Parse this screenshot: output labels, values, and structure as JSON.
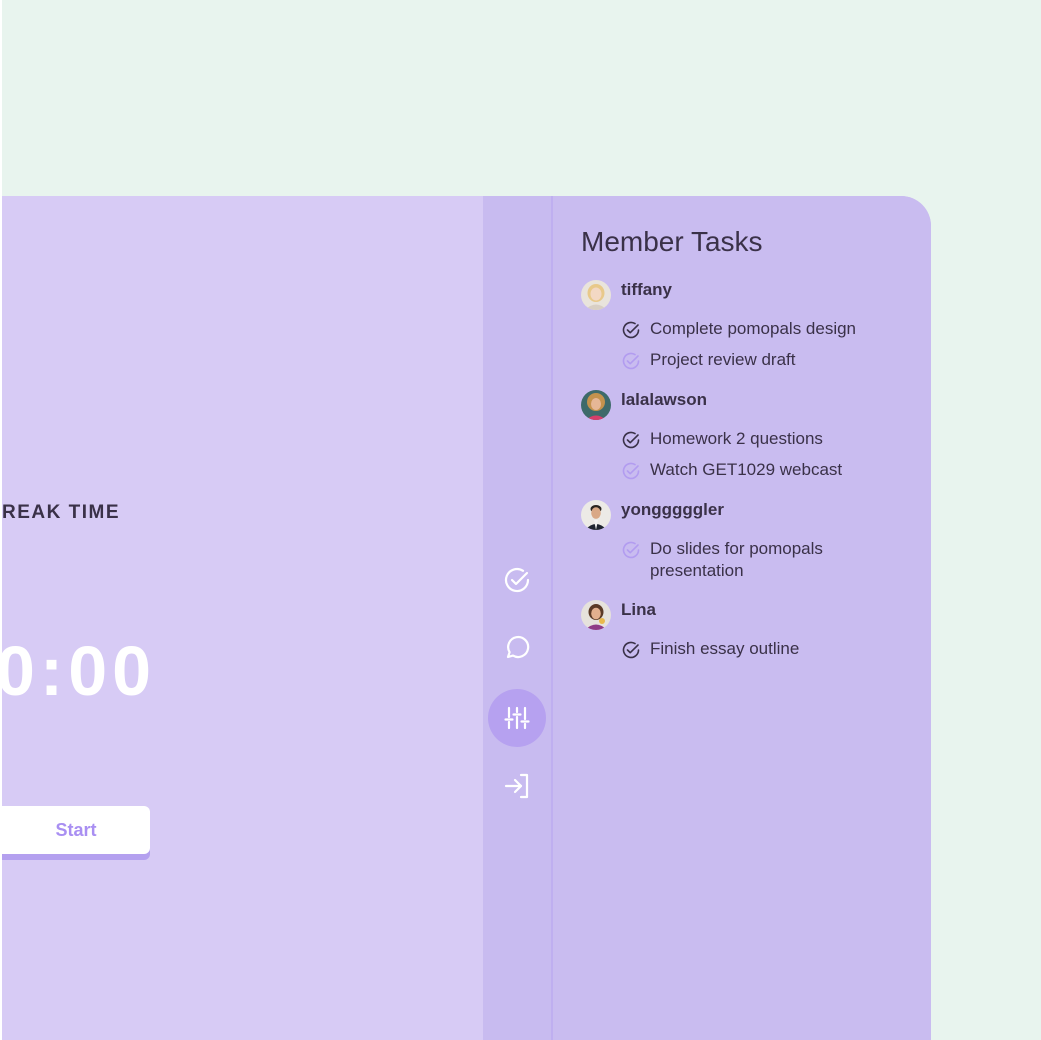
{
  "timer": {
    "mode_label": "REAK TIME",
    "display": "0:00",
    "start_label": "Start"
  },
  "rail": {
    "items": [
      {
        "icon": "check-circle-icon",
        "active": false
      },
      {
        "icon": "chat-bubble-icon",
        "active": false
      },
      {
        "icon": "sliders-icon",
        "active": true
      },
      {
        "icon": "exit-arrow-icon",
        "active": false
      }
    ]
  },
  "tasks_panel": {
    "title": "Member Tasks",
    "members": [
      {
        "name": "tiffany",
        "tasks": [
          {
            "text": "Complete pomopals design",
            "done": true
          },
          {
            "text": "Project review draft",
            "done": false
          }
        ]
      },
      {
        "name": "lalalawson",
        "tasks": [
          {
            "text": "Homework 2 questions",
            "done": true
          },
          {
            "text": "Watch GET1029 webcast",
            "done": false
          }
        ]
      },
      {
        "name": "yongggggler",
        "tasks": [
          {
            "text": "Do slides for pomopals presentation",
            "done": false
          }
        ]
      },
      {
        "name": "Lina",
        "tasks": [
          {
            "text": "Finish essay outline",
            "done": true
          }
        ]
      }
    ]
  },
  "colors": {
    "background": "#e8f4ee",
    "timer_panel": "#d7cbf5",
    "rail": "#c8bbf0",
    "tasks_panel": "#c9bcf0",
    "accent": "#a98ff2",
    "text_dark": "#3a3148",
    "check_done": "#3a3148",
    "check_pending": "#b29cf0"
  }
}
